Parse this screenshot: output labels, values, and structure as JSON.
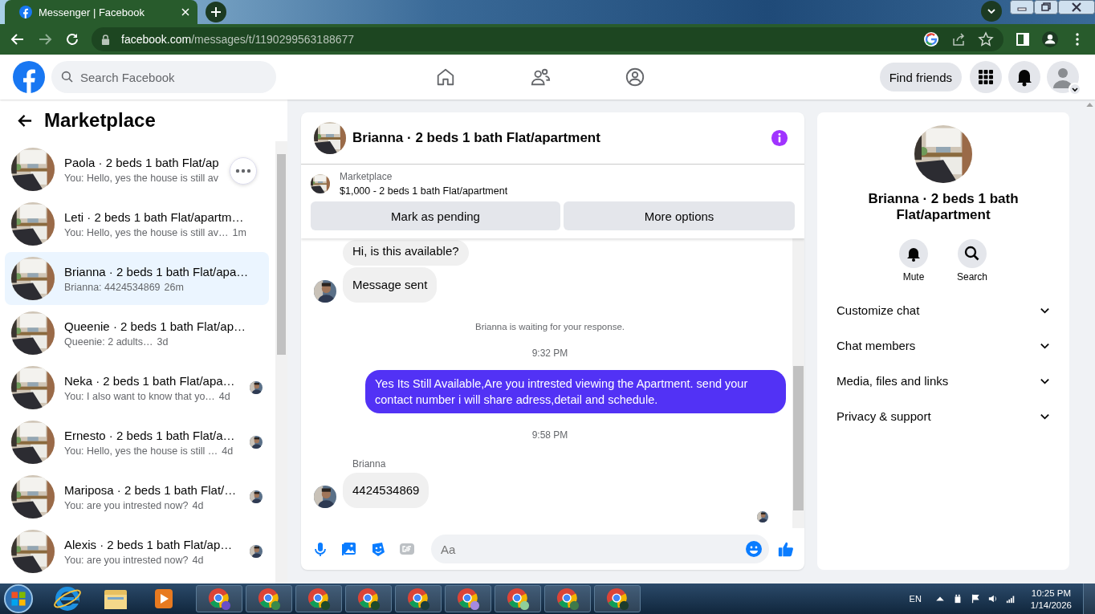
{
  "browser": {
    "tab_title": "Messenger | Facebook",
    "url_host": "facebook.com",
    "url_path": "/messages/t/1190299563188677"
  },
  "topbar": {
    "search": {
      "placeholder": "Search Facebook"
    },
    "find_friends": "Find friends"
  },
  "sidebar": {
    "title": "Marketplace",
    "conversations": [
      {
        "title": "Paola · 2 beds 1 bath Flat/ap",
        "preview": "You: Hello, yes the house is still av",
        "selected": false,
        "seen": false,
        "more_button": true
      },
      {
        "title": "Leti · 2 beds 1 bath Flat/apartm…",
        "preview": "You: Hello, yes the house is still av…",
        "time": "1m",
        "selected": false,
        "seen": false,
        "more_button": false
      },
      {
        "title": "Brianna · 2 beds 1 bath Flat/apa…",
        "preview": "Brianna: 4424534869",
        "time": "26m",
        "selected": true,
        "seen": false,
        "more_button": false
      },
      {
        "title": "Queenie · 2 beds 1 bath Flat/ap…",
        "preview": "Queenie: 2 adults…",
        "time": "3d",
        "selected": false,
        "seen": false,
        "more_button": false
      },
      {
        "title": "Neka · 2 beds 1 bath Flat/apa…",
        "preview": "You: I also want to know that yo…",
        "time": "4d",
        "selected": false,
        "seen": true,
        "more_button": false
      },
      {
        "title": "Ernesto · 2 beds 1 bath Flat/a…",
        "preview": "You: Hello, yes the house is still …",
        "time": "4d",
        "selected": false,
        "seen": true,
        "more_button": false
      },
      {
        "title": "Mariposa · 2 beds 1 bath Flat/…",
        "preview": "You: are you intrested now?",
        "time": "4d",
        "selected": false,
        "seen": true,
        "more_button": false
      },
      {
        "title": "Alexis · 2 beds 1 bath Flat/ap…",
        "preview": "You: are you intrested now?",
        "time": "4d",
        "selected": false,
        "seen": true,
        "more_button": false
      }
    ]
  },
  "chat": {
    "title": "Brianna · 2 beds 1 bath Flat/apartment",
    "listing": {
      "label": "Marketplace",
      "summary": "$1,000 - 2 beds 1 bath Flat/apartment"
    },
    "actions": [
      "Mark as pending",
      "More options"
    ],
    "messages": [
      {
        "kind": "incoming",
        "text": "Hi, is this available?",
        "avatar": false
      },
      {
        "kind": "incoming",
        "text": "Message sent",
        "avatar": true
      },
      {
        "kind": "system",
        "text": "Brianna is waiting for your response."
      },
      {
        "kind": "time",
        "text": "9:32 PM"
      },
      {
        "kind": "outgoing",
        "text": "Yes Its Still Available,Are you intrested viewing the Apartment. send your contact number i will share adress,detail and schedule."
      },
      {
        "kind": "time",
        "text": "9:58 PM"
      },
      {
        "kind": "sender",
        "text": "Brianna"
      },
      {
        "kind": "incoming",
        "text": "4424534869",
        "avatar": true
      },
      {
        "kind": "receipt"
      }
    ],
    "composer": {
      "placeholder": "Aa"
    }
  },
  "details": {
    "title": "Brianna · 2 beds 1 bath Flat/apartment",
    "actions": [
      {
        "kind": "bell",
        "label": "Mute"
      },
      {
        "kind": "search",
        "label": "Search"
      }
    ],
    "sections": [
      {
        "label": "Customize chat",
        "expanded": false
      },
      {
        "label": "Chat members",
        "expanded": false
      },
      {
        "label": "Media, files and links",
        "expanded": false
      },
      {
        "label": "Privacy & support",
        "expanded": false
      }
    ]
  },
  "taskbar": {
    "apps": [
      {
        "kind": "start"
      },
      {
        "kind": "ie"
      },
      {
        "kind": "folder"
      },
      {
        "kind": "media"
      },
      {
        "kind": "chrome",
        "color": "#6a4fc8"
      },
      {
        "kind": "chrome",
        "color": "#3a8a4a"
      },
      {
        "kind": "chrome",
        "color": "#1e4a2a"
      },
      {
        "kind": "chrome",
        "color": "#1e4a2b"
      },
      {
        "kind": "chrome",
        "color": "#1c3c3c"
      },
      {
        "kind": "chrome",
        "color": "#a58ae0"
      },
      {
        "kind": "chrome",
        "color": "#8fcf9a"
      },
      {
        "kind": "chrome",
        "color": "#3e7a4a"
      },
      {
        "kind": "chrome",
        "color": "#1c3c2c"
      }
    ],
    "language": "EN",
    "time": "10:25 PM",
    "date": "1/14/2026"
  }
}
